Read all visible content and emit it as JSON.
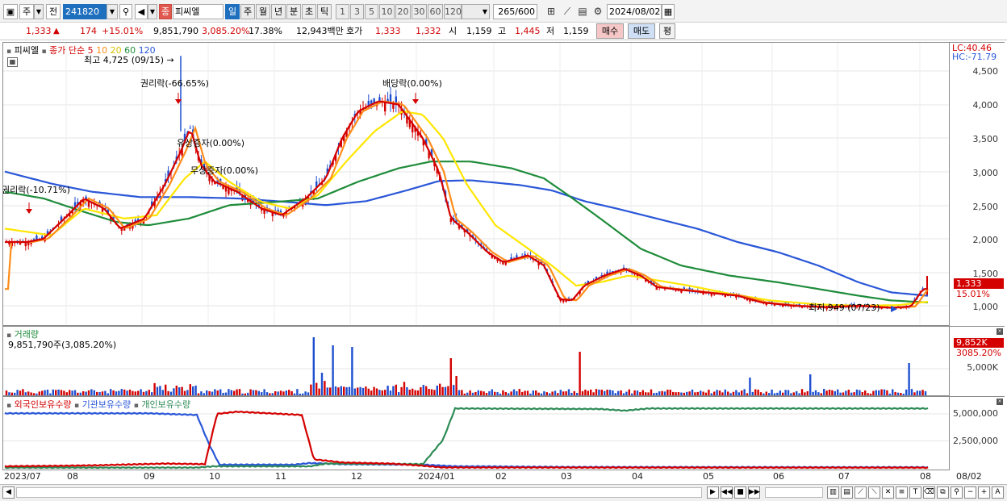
{
  "toolbar": {
    "market_label": "주",
    "prev_label": "전",
    "code": "241820",
    "stock_badge": "종",
    "stock_name": "피씨엘",
    "periods": [
      "일",
      "주",
      "월",
      "년",
      "분",
      "초",
      "틱"
    ],
    "active_period": "일",
    "intervals": [
      "1",
      "3",
      "5",
      "10",
      "20",
      "30",
      "60",
      "120"
    ],
    "count": "265",
    "count_total": "/600",
    "date": "2024/08/02"
  },
  "quote": {
    "price": "1,333",
    "change": "174",
    "change_pct": "+15.01%",
    "volume": "9,851,790",
    "volume_pct": "3,085.20%",
    "turnover_pct": "17.38%",
    "amount": "12,943백만",
    "bid_ask_label": "호가",
    "ask": "1,333",
    "bid": "1,332",
    "open_label": "시",
    "open": "1,159",
    "high_label": "고",
    "high": "1,445",
    "low_label": "저",
    "low": "1,159",
    "buy": "매수",
    "sell": "매도",
    "eval": "평"
  },
  "price_panel": {
    "name": "피씨엘",
    "ma_legend": "종가 단순 5",
    "ma_periods": [
      "10",
      "20",
      "60",
      "120"
    ],
    "ma_colors": [
      "#d40000",
      "#ff8c1a",
      "#ffe600",
      "#1e8c3a",
      "#2a57d8"
    ],
    "high_note": "최고 4,725 (09/15)",
    "low_note": "최저 949 (07/23)",
    "annotations": [
      "권리락(-66.65%)",
      "배당락(0.00%)",
      "유상증자(0.00%)",
      "무상증자(0.00%)",
      "권리락(-10.71%)"
    ],
    "lc": "LC:40.46",
    "hc": "HC:-71.79",
    "y_ticks": [
      "4,500",
      "4,000",
      "3,500",
      "3,000",
      "2,500",
      "2,000",
      "1,500",
      "1,000"
    ],
    "price_tag": "1,333",
    "pct_tag": "15.01%"
  },
  "volume_panel": {
    "title": "거래량",
    "info": "9,851,790주(3,085.20%)",
    "tag": "9,852K",
    "tag_pct": "3085.20%",
    "y_tick": "5,000K"
  },
  "holders_panel": {
    "series": [
      "외국인보유수량",
      "기관보유수량",
      "개인보유수량"
    ],
    "colors": [
      "#d40000",
      "#2a57d8",
      "#2e8b57"
    ],
    "y_ticks": [
      "5,000,000",
      "2,500,000"
    ]
  },
  "x_axis": {
    "labels": [
      "2023/07",
      "08",
      "09",
      "10",
      "11",
      "12",
      "2024/01",
      "02",
      "03",
      "04",
      "05",
      "06",
      "07",
      "08"
    ],
    "end_label": "08/02"
  },
  "chart_data": {
    "type": "line",
    "title": "",
    "xlabel": "",
    "ylabel": "",
    "x": [
      "2023/07",
      "08",
      "09",
      "10",
      "11",
      "12",
      "2024/01",
      "02",
      "03",
      "04",
      "05",
      "06",
      "07",
      "08"
    ],
    "ylim": [
      900,
      4700
    ],
    "series": [
      {
        "name": "5",
        "values": [
          1950,
          2600,
          3700,
          2700,
          2500,
          3900,
          3300,
          1700,
          1050,
          1500,
          1200,
          1020,
          980,
          1333
        ]
      },
      {
        "name": "120",
        "values": [
          3000,
          2700,
          2600,
          2550,
          2500,
          2700,
          2880,
          2800,
          2600,
          2200,
          1800,
          1450,
          1200,
          1120
        ]
      }
    ]
  }
}
